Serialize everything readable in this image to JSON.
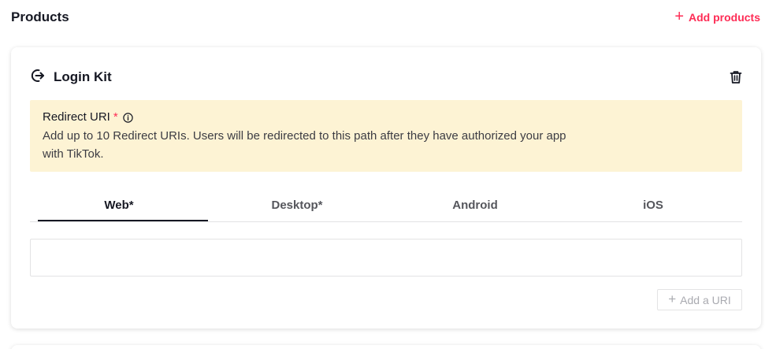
{
  "header": {
    "title": "Products",
    "add_products_label": "Add products",
    "accent_color": "#fe2c55"
  },
  "login_kit": {
    "title": "Login Kit",
    "icon": "login-arrow-icon",
    "delete_icon": "trash-icon",
    "notice": {
      "title": "Redirect URI",
      "required_mark": "*",
      "info_icon": "info-icon",
      "description": "Add up to 10 Redirect URIs. Users will be redirected to this path after they have authorized your app with TikTok.",
      "background": "#fdf3d4"
    },
    "tabs": [
      {
        "label": "Web*",
        "active": true
      },
      {
        "label": "Desktop*",
        "active": false
      },
      {
        "label": "Android",
        "active": false
      },
      {
        "label": "iOS",
        "active": false
      }
    ],
    "uri_input": {
      "value": "",
      "placeholder": ""
    },
    "add_uri_label": "Add a URI"
  }
}
